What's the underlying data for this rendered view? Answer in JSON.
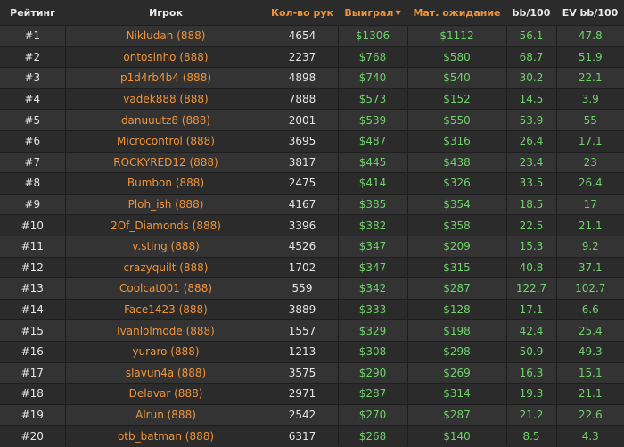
{
  "headers": {
    "rank": "Рейтинг",
    "player": "Игрок",
    "hands": "Кол-во рук",
    "won": "Выиграл",
    "ev": "Мат. ожидание",
    "bb100": "bb/100",
    "evbb100": "EV bb/100"
  },
  "icons": {
    "sort": "sort-desc-icon"
  },
  "colors": {
    "accent": "#f0943a",
    "positive": "#6fd36a",
    "text": "#e6e6e6",
    "row_odd": "#333333",
    "row_even": "#2b2b2b"
  },
  "rows": [
    {
      "rank": "#1",
      "player": "Nikludan (888)",
      "hands": "4654",
      "won": "$1306",
      "ev": "$1112",
      "bb100": "56.1",
      "evbb100": "47.8"
    },
    {
      "rank": "#2",
      "player": "ontosinho (888)",
      "hands": "2237",
      "won": "$768",
      "ev": "$580",
      "bb100": "68.7",
      "evbb100": "51.9"
    },
    {
      "rank": "#3",
      "player": "p1d4rb4b4 (888)",
      "hands": "4898",
      "won": "$740",
      "ev": "$540",
      "bb100": "30.2",
      "evbb100": "22.1"
    },
    {
      "rank": "#4",
      "player": "vadek888 (888)",
      "hands": "7888",
      "won": "$573",
      "ev": "$152",
      "bb100": "14.5",
      "evbb100": "3.9"
    },
    {
      "rank": "#5",
      "player": "danuuutz8 (888)",
      "hands": "2001",
      "won": "$539",
      "ev": "$550",
      "bb100": "53.9",
      "evbb100": "55"
    },
    {
      "rank": "#6",
      "player": "Microcontrol (888)",
      "hands": "3695",
      "won": "$487",
      "ev": "$316",
      "bb100": "26.4",
      "evbb100": "17.1"
    },
    {
      "rank": "#7",
      "player": "ROCKYRED12 (888)",
      "hands": "3817",
      "won": "$445",
      "ev": "$438",
      "bb100": "23.4",
      "evbb100": "23"
    },
    {
      "rank": "#8",
      "player": "Bumbon (888)",
      "hands": "2475",
      "won": "$414",
      "ev": "$326",
      "bb100": "33.5",
      "evbb100": "26.4"
    },
    {
      "rank": "#9",
      "player": "Ploh_ish (888)",
      "hands": "4167",
      "won": "$385",
      "ev": "$354",
      "bb100": "18.5",
      "evbb100": "17"
    },
    {
      "rank": "#10",
      "player": "2Of_Diamonds (888)",
      "hands": "3396",
      "won": "$382",
      "ev": "$358",
      "bb100": "22.5",
      "evbb100": "21.1"
    },
    {
      "rank": "#11",
      "player": "v.sting (888)",
      "hands": "4526",
      "won": "$347",
      "ev": "$209",
      "bb100": "15.3",
      "evbb100": "9.2"
    },
    {
      "rank": "#12",
      "player": "crazyquilt (888)",
      "hands": "1702",
      "won": "$347",
      "ev": "$315",
      "bb100": "40.8",
      "evbb100": "37.1"
    },
    {
      "rank": "#13",
      "player": "Coolcat001 (888)",
      "hands": "559",
      "won": "$342",
      "ev": "$287",
      "bb100": "122.7",
      "evbb100": "102.7"
    },
    {
      "rank": "#14",
      "player": "Face1423 (888)",
      "hands": "3889",
      "won": "$333",
      "ev": "$128",
      "bb100": "17.1",
      "evbb100": "6.6"
    },
    {
      "rank": "#15",
      "player": "Ivanlolmode (888)",
      "hands": "1557",
      "won": "$329",
      "ev": "$198",
      "bb100": "42.4",
      "evbb100": "25.4"
    },
    {
      "rank": "#16",
      "player": "yuraro (888)",
      "hands": "1213",
      "won": "$308",
      "ev": "$298",
      "bb100": "50.9",
      "evbb100": "49.3"
    },
    {
      "rank": "#17",
      "player": "slavun4a (888)",
      "hands": "3575",
      "won": "$290",
      "ev": "$269",
      "bb100": "16.3",
      "evbb100": "15.1"
    },
    {
      "rank": "#18",
      "player": "Delavar (888)",
      "hands": "2971",
      "won": "$287",
      "ev": "$314",
      "bb100": "19.3",
      "evbb100": "21.1"
    },
    {
      "rank": "#19",
      "player": "Alrun (888)",
      "hands": "2542",
      "won": "$270",
      "ev": "$287",
      "bb100": "21.2",
      "evbb100": "22.6"
    },
    {
      "rank": "#20",
      "player": "otb_batman (888)",
      "hands": "6317",
      "won": "$268",
      "ev": "$140",
      "bb100": "8.5",
      "evbb100": "4.3"
    }
  ]
}
